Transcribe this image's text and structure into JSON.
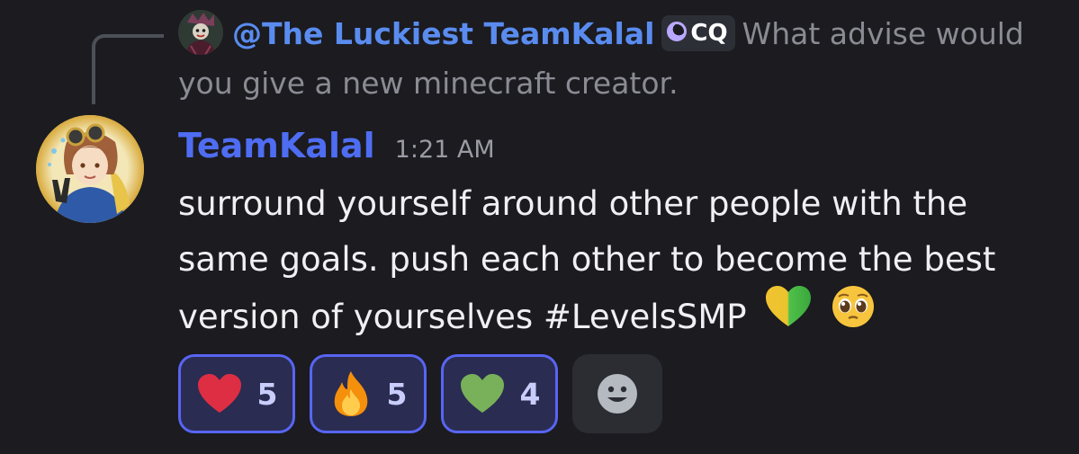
{
  "reply": {
    "mention": "@The Luckiest TeamKalal",
    "tag": "CQ",
    "text": "What advise would you give a new minecraft creator."
  },
  "message": {
    "author": "TeamKalal",
    "timestamp": "1:21 AM",
    "text": "surround yourself around other people with the same goals. push each other to become the best version of yourselves #LevelsSMP"
  },
  "reactions": [
    {
      "icon": "red-heart-icon",
      "count": "5"
    },
    {
      "icon": "fire-icon",
      "count": "5"
    },
    {
      "icon": "green-heart-icon",
      "count": "4"
    }
  ],
  "colors": {
    "background": "#1b1b20",
    "mention": "#5a8cf0",
    "username": "#4f6df2",
    "reaction_border": "#5865f2",
    "reaction_bg": "#2a2c52"
  }
}
